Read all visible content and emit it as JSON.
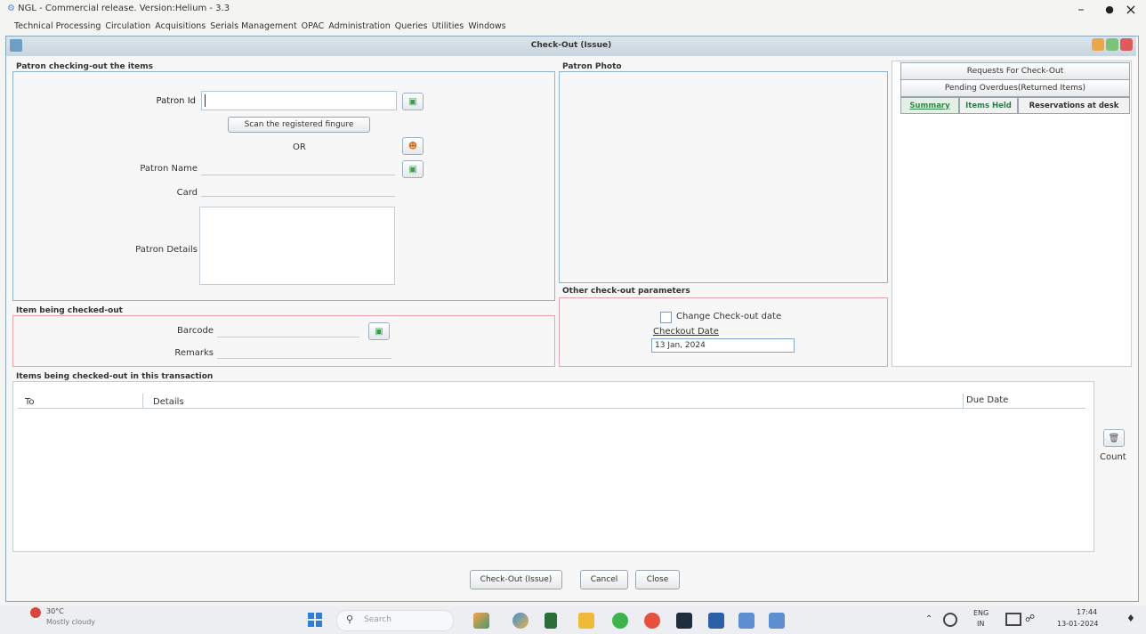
{
  "app": {
    "title": "NGL - Commercial release. Version:Helium - 3.3"
  },
  "window_controls": {
    "minimize": "–",
    "restore": "●",
    "close": "×"
  },
  "menu": [
    "Technical Processing",
    "Circulation",
    "Acquisitions",
    "Serials Management",
    "OPAC",
    "Administration",
    "Queries",
    "Utilities",
    "Windows"
  ],
  "dialog": {
    "title": "Check-Out (Issue)"
  },
  "patron": {
    "header": "Patron checking-out the items",
    "id_label": "Patron Id",
    "id_value": "",
    "scan_button": "Scan the registered fingure",
    "or_text": "OR",
    "name_label": "Patron Name",
    "card_label": "Card",
    "details_label": "Patron Details"
  },
  "photo": {
    "header": "Patron Photo"
  },
  "right_panel": {
    "requests": "Requests For Check-Out",
    "pending": "Pending Overdues(Returned Items)",
    "tabs": [
      "Summary",
      "Items Held",
      "Reservations at desk"
    ]
  },
  "item": {
    "header": "Item being checked-out",
    "barcode_label": "Barcode",
    "remarks_label": "Remarks"
  },
  "params": {
    "header": "Other check-out parameters",
    "change_date_label": "Change Check-out date",
    "checkout_date_label": "Checkout Date",
    "checkout_date_value": "13 Jan, 2024"
  },
  "transaction": {
    "header": "Items being checked-out in this transaction",
    "columns": [
      "To",
      "Details",
      "Due Date"
    ],
    "count_label": "Count"
  },
  "buttons": {
    "checkout": "Check-Out (Issue)",
    "cancel": "Cancel",
    "close": "Close"
  },
  "taskbar": {
    "weather_temp": "30°C",
    "weather_desc": "Mostly cloudy",
    "search_placeholder": "Search",
    "lang1": "ENG",
    "lang2": "IN",
    "time": "17:44",
    "date": "13-01-2024"
  }
}
